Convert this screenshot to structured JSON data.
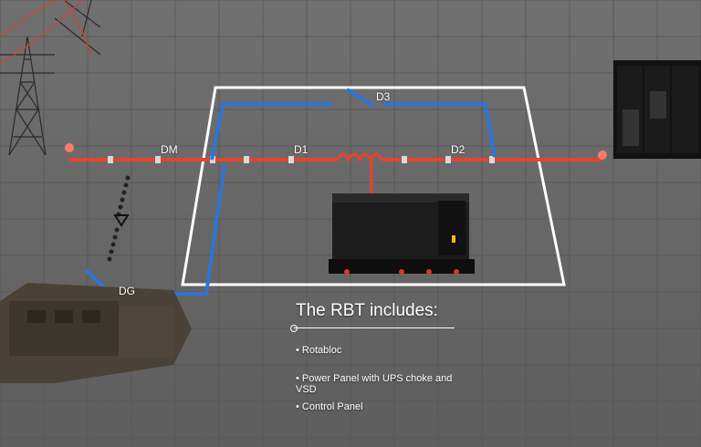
{
  "labels": {
    "dm": "DM",
    "d1": "D1",
    "d2": "D2",
    "d3": "D3",
    "dg": "DG"
  },
  "caption": {
    "title": "The RBT includes:",
    "items": [
      "• Rotabloc",
      "• Power Panel with UPS choke and VSD",
      "• Control Panel"
    ]
  },
  "colors": {
    "floor": "#6a6a6a",
    "grid": "#5a5a5a",
    "red_line": "#e8412c",
    "blue_line": "#2f73d6",
    "outline": "#ffffff",
    "equipment": "#1c1c1c"
  }
}
